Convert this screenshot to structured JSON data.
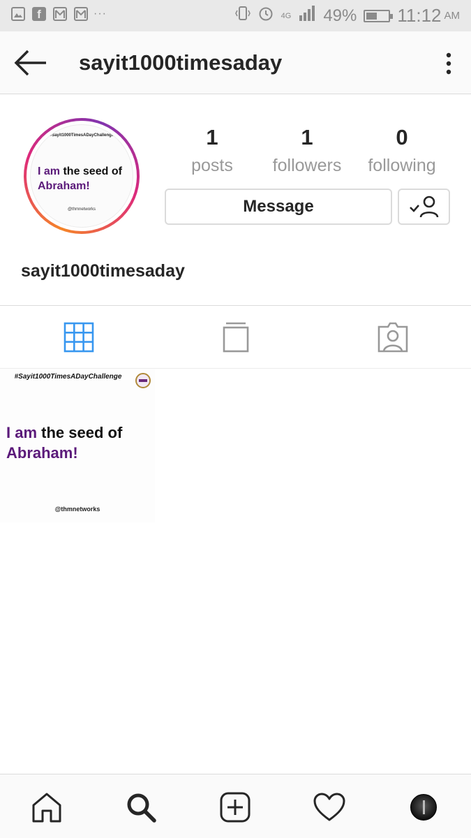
{
  "status_bar": {
    "facebook_glyph": "f",
    "network_label": "4G",
    "battery_percent": "49%",
    "battery_level": 0.49,
    "time": "11:12",
    "ampm": "AM",
    "icons": [
      "image-icon",
      "facebook-icon",
      "gmail-icon",
      "gmail-icon",
      "more-notifications-icon",
      "vibrate-icon",
      "alarm-icon",
      "signal-icon",
      "battery-icon"
    ]
  },
  "header": {
    "title": "sayit1000timesaday",
    "back_icon": "back-arrow-icon",
    "more_icon": "more-vertical-icon"
  },
  "profile": {
    "avatar": {
      "tag": "#Sayit1000TimesADayChallenge",
      "line1_purple": "I am",
      "line1_rest": " the seed of",
      "line2": "Abraham!",
      "handle": "@thmnetworks"
    },
    "stats": [
      {
        "value": "1",
        "label": "posts"
      },
      {
        "value": "1",
        "label": "followers"
      },
      {
        "value": "0",
        "label": "following"
      }
    ],
    "message_button": "Message",
    "follow_icon": "following-check-user-icon",
    "name": "sayit1000timesaday"
  },
  "tabs": [
    {
      "icon": "grid-icon",
      "active": true
    },
    {
      "icon": "igtv-icon",
      "active": false
    },
    {
      "icon": "tagged-user-icon",
      "active": false
    }
  ],
  "posts": [
    {
      "tag": "#Sayit1000TimesADayChallenge",
      "line1_purple": "I am",
      "line1_rest": " the seed of",
      "line2": "Abraham!",
      "handle": "@thmnetworks"
    }
  ],
  "colors": {
    "active_tab": "#3897f0",
    "inactive_icon": "#999999",
    "text": "#262626",
    "purple_text": "#5b1a7a",
    "border": "#dbdbdb"
  },
  "bottom_nav": [
    "home-icon",
    "search-icon",
    "new-post-icon",
    "activity-heart-icon",
    "profile-avatar-icon"
  ]
}
